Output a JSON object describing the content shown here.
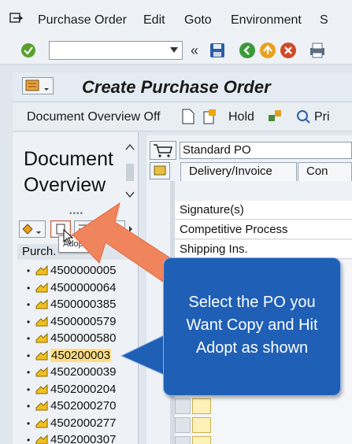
{
  "menu": {
    "items": [
      "Purchase Order",
      "Edit",
      "Goto",
      "Environment",
      "S"
    ]
  },
  "screen": {
    "title": "Create Purchase Order"
  },
  "app_toolbar": {
    "doc_overview": "Document Overview Off",
    "hold": "Hold",
    "print_partial": "Pri"
  },
  "left_panel": {
    "heading_line1": "Document",
    "heading_line2": "Overview",
    "column_header": "Purch.",
    "tooltip": "Adopt",
    "po_numbers": [
      "4500000005",
      "4500000064",
      "4500000385",
      "4500000579",
      "4500000580",
      "450200003",
      "4502000039",
      "4502000204",
      "4502000270",
      "4502000277",
      "4502000307"
    ],
    "selected_index": 5
  },
  "right_panel": {
    "doc_type": "Standard PO",
    "tabs": [
      "Delivery/Invoice",
      "Con"
    ],
    "fields": [
      "Signature(s)",
      "Competitive Process",
      "Shipping Ins."
    ]
  },
  "callout": {
    "line1": "Select the PO you",
    "line2": "Want Copy and Hit",
    "line3": "Adopt as shown"
  },
  "colors": {
    "callout_bg": "#1f5fb5",
    "arrow": "#f0845d",
    "selection": "#ffde85"
  }
}
